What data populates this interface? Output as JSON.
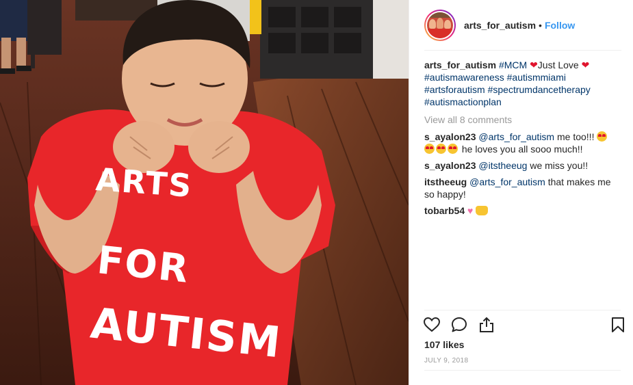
{
  "post": {
    "username": "arts_for_autism",
    "separator": "•",
    "follow_label": "Follow",
    "caption": {
      "username": "arts_for_autism",
      "text_parts": [
        "#MCM",
        "❤",
        "Just Love",
        "❤"
      ],
      "hashtags": [
        "#autismawareness",
        "#autismmiami",
        "#artsforautism",
        "#spectrumdancetherapy",
        "#autismactionplan"
      ]
    },
    "view_all_comments": "View all 8 comments",
    "comments": [
      {
        "user": "s_ayalon23",
        "mention": "@arts_for_autism",
        "text_a": "me too!!!",
        "text_b": "he loves you all sooo much!!"
      },
      {
        "user": "s_ayalon23",
        "mention": "@itstheeug",
        "text_a": "we miss you!!"
      },
      {
        "user": "itstheeug",
        "mention": "@arts_for_autism",
        "text_a": "that makes me so happy!"
      },
      {
        "user": "tobarb54",
        "text_a": ""
      }
    ],
    "likes": "107 likes",
    "date": "JULY 9, 2018",
    "photo_shirt_text": [
      "ARTS",
      "FOR",
      "AUTISM"
    ]
  },
  "icons": {
    "like": "heart-outline-icon",
    "comment": "speech-bubble-icon",
    "share": "share-upload-icon",
    "save": "bookmark-icon"
  },
  "colors": {
    "accent_link": "#3897f0",
    "hashtag": "#003569",
    "shirt": "#e8262a",
    "meta_gray": "#999999"
  }
}
